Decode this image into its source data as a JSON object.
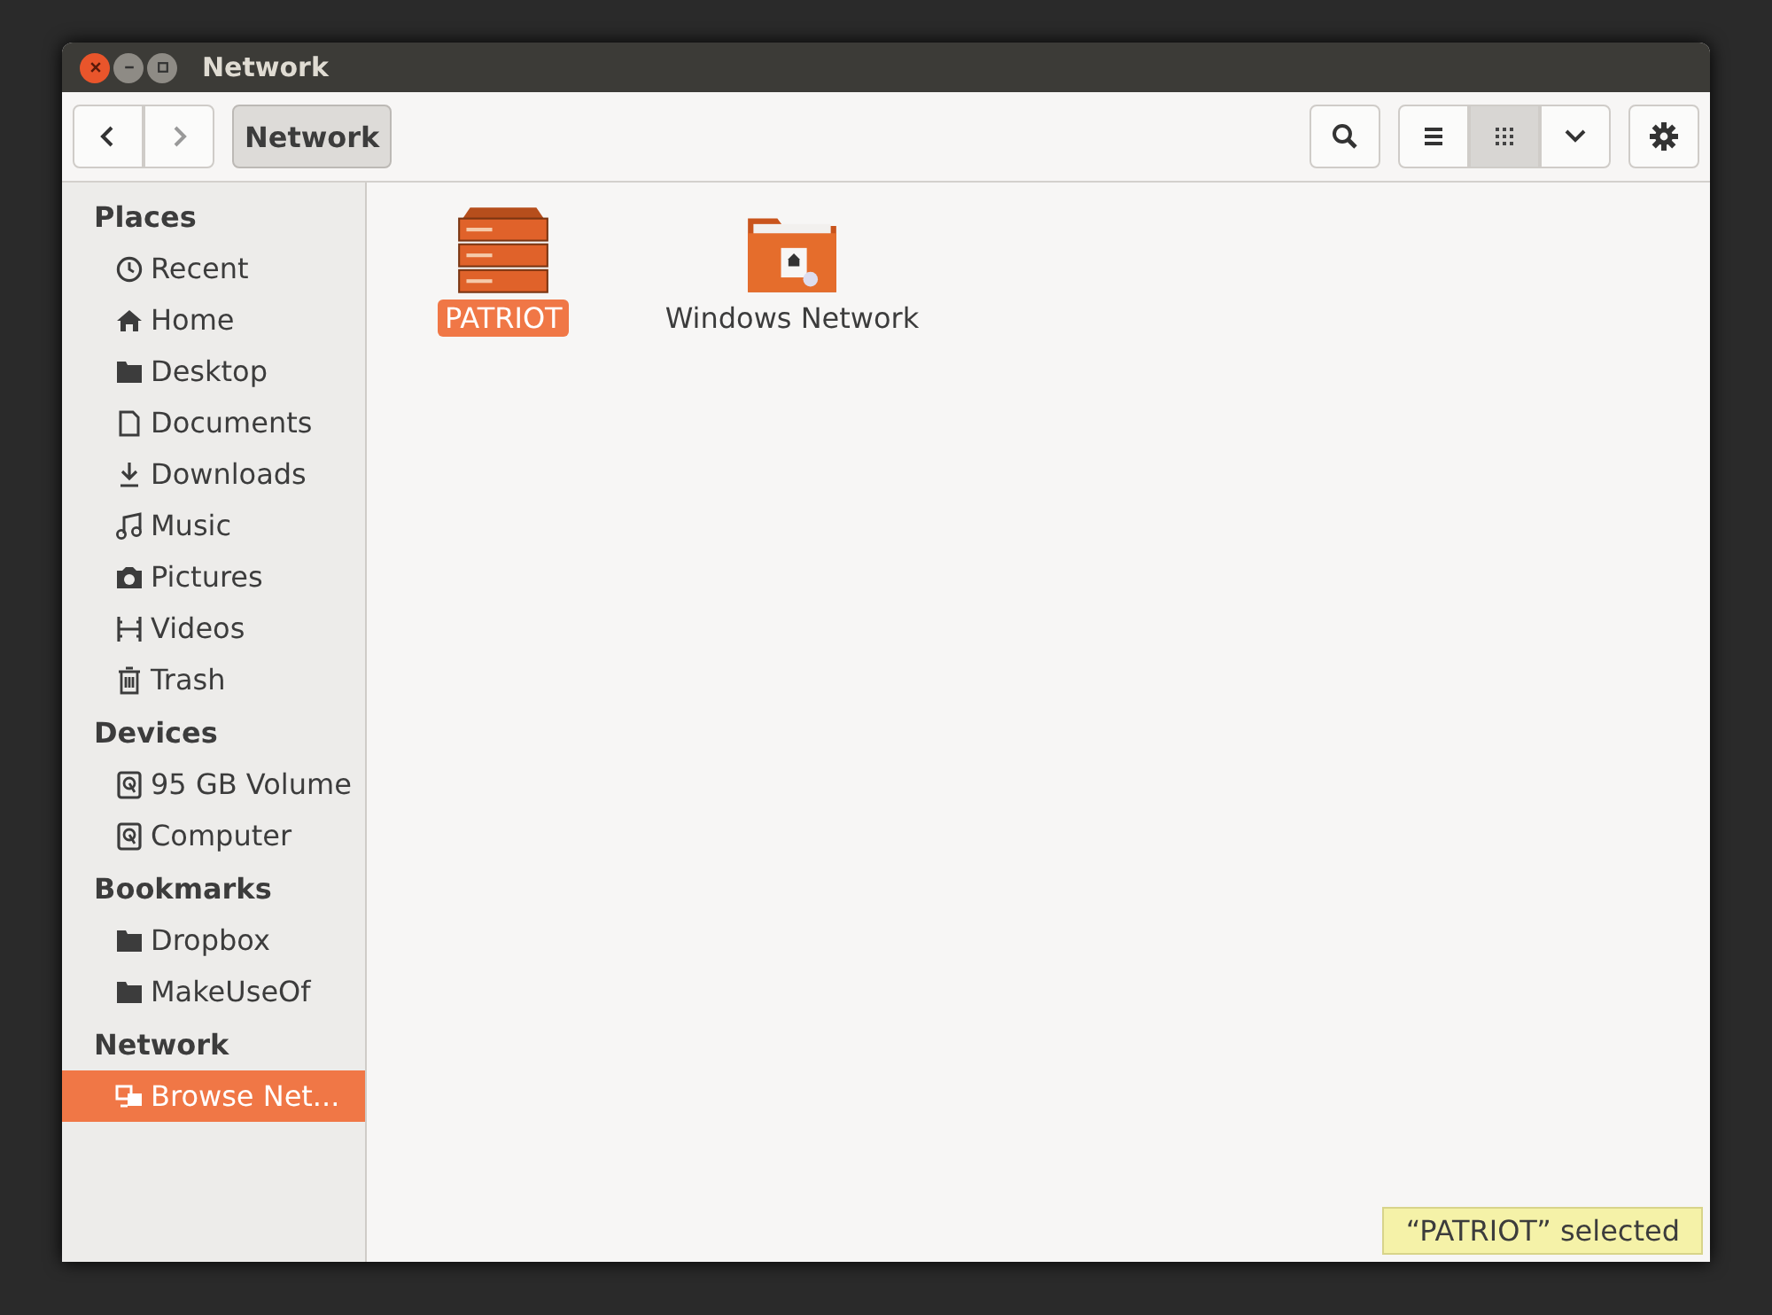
{
  "window": {
    "title": "Network"
  },
  "toolbar": {
    "path": [
      {
        "label": "Network",
        "selected": true
      }
    ],
    "views": [
      {
        "kind": "list",
        "selected": false
      },
      {
        "kind": "grid",
        "selected": true
      }
    ]
  },
  "sidebar": {
    "sections": [
      {
        "title": "Places",
        "items": [
          {
            "label": "Recent",
            "kind": "recent",
            "selected": false
          },
          {
            "label": "Home",
            "kind": "home",
            "selected": false
          },
          {
            "label": "Desktop",
            "kind": "folder",
            "selected": false
          },
          {
            "label": "Documents",
            "kind": "document",
            "selected": false
          },
          {
            "label": "Downloads",
            "kind": "download",
            "selected": false
          },
          {
            "label": "Music",
            "kind": "music",
            "selected": false
          },
          {
            "label": "Pictures",
            "kind": "camera",
            "selected": false
          },
          {
            "label": "Videos",
            "kind": "film",
            "selected": false
          },
          {
            "label": "Trash",
            "kind": "trash",
            "selected": false
          }
        ]
      },
      {
        "title": "Devices",
        "items": [
          {
            "label": "95 GB Volume",
            "kind": "drive",
            "selected": false
          },
          {
            "label": "Computer",
            "kind": "drive",
            "selected": false
          }
        ]
      },
      {
        "title": "Bookmarks",
        "items": [
          {
            "label": "Dropbox",
            "kind": "folder",
            "selected": false
          },
          {
            "label": "MakeUseOf",
            "kind": "folder",
            "selected": false
          }
        ]
      },
      {
        "title": "Network",
        "items": [
          {
            "label": "Browse Net...",
            "kind": "network",
            "selected": true
          }
        ]
      }
    ]
  },
  "files": [
    {
      "name": "PATRIOT",
      "kind": "server",
      "selected": true
    },
    {
      "name": "Windows Network",
      "kind": "network-folder",
      "selected": false
    }
  ],
  "status_bar": {
    "text": "“PATRIOT” selected"
  }
}
